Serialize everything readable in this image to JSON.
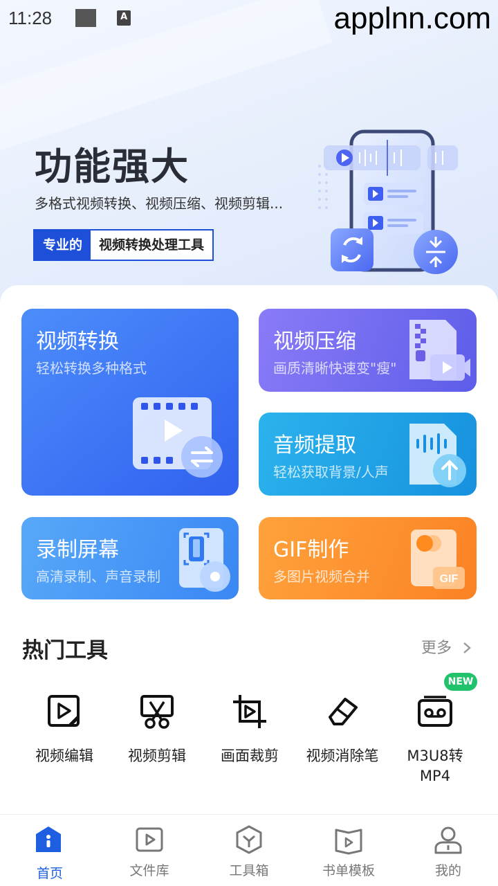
{
  "status_bar": {
    "time": "11:28",
    "app_letter": "A"
  },
  "watermark": "applnn.com",
  "hero": {
    "title": "功能强大",
    "subtitle": "多格式视频转换、视频压缩、视频剪辑...",
    "tag_primary": "专业的",
    "tag_secondary": "视频转换处理工具"
  },
  "features": {
    "convert": {
      "title": "视频转换",
      "subtitle": "轻松转换多种格式"
    },
    "compress": {
      "title": "视频压缩",
      "subtitle": "画质清晰快速变\"瘦\""
    },
    "audio": {
      "title": "音频提取",
      "subtitle": "轻松获取背景/人声"
    },
    "record": {
      "title": "录制屏幕",
      "subtitle": "高清录制、声音录制"
    },
    "gif": {
      "title": "GIF制作",
      "subtitle": "多图片视频合并",
      "badge": "GIF"
    }
  },
  "hot_tools": {
    "title": "热门工具",
    "more": "更多",
    "items": [
      {
        "label": "视频编辑",
        "icon": "video-edit-icon"
      },
      {
        "label": "视频剪辑",
        "icon": "scissors-icon"
      },
      {
        "label": "画面裁剪",
        "icon": "crop-icon"
      },
      {
        "label": "视频消除笔",
        "icon": "eraser-icon"
      },
      {
        "label": "M3U8转MP4",
        "icon": "cassette-icon",
        "badge": "NEW"
      }
    ]
  },
  "tabbar": {
    "items": [
      {
        "label": "首页",
        "icon": "home-icon",
        "active": true
      },
      {
        "label": "文件库",
        "icon": "video-library-icon"
      },
      {
        "label": "工具箱",
        "icon": "toolbox-icon"
      },
      {
        "label": "书单模板",
        "icon": "book-template-icon"
      },
      {
        "label": "我的",
        "icon": "profile-icon"
      }
    ]
  },
  "colors": {
    "brand_blue": "#1d4fd8",
    "active_tab": "#1d5fe0",
    "new_badge": "#22c26d"
  }
}
